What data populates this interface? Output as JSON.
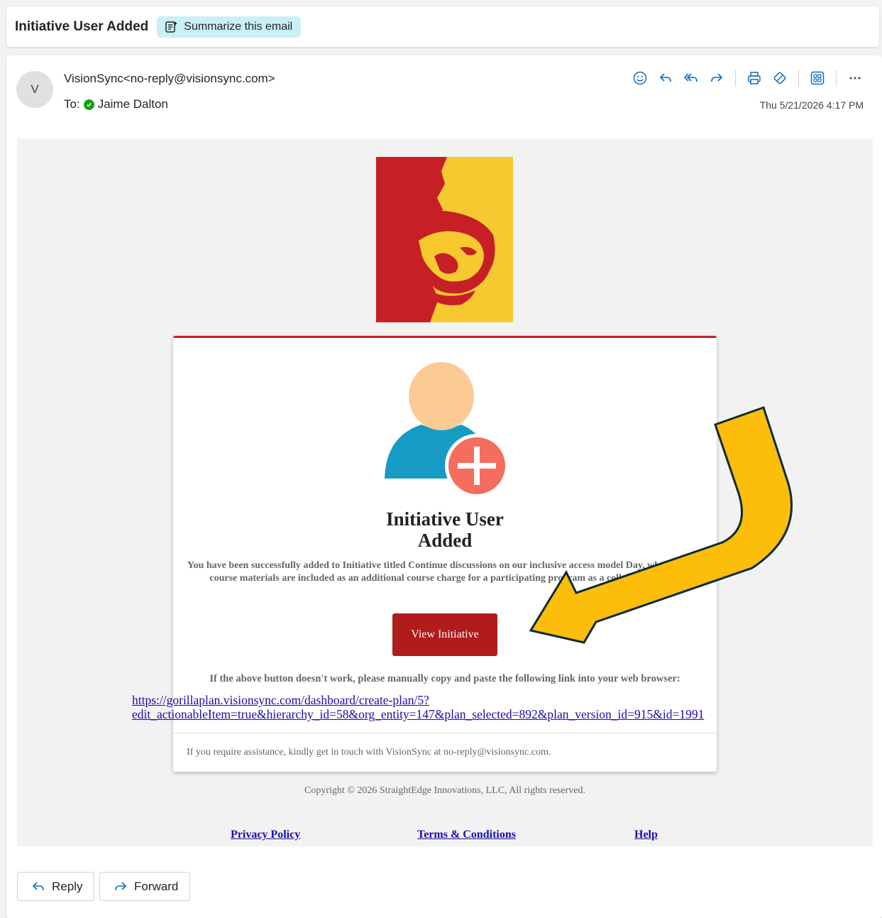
{
  "subject": {
    "title": "Initiative User Added",
    "summarize_label": "Summarize this email"
  },
  "message": {
    "avatar_initial": "V",
    "sender_name": "VisionSync",
    "sender_email": "<no-reply@visionsync.com>",
    "to_label": "To:",
    "recipient": "Jaime Dalton",
    "timestamp": "Thu 5/21/2026 4:17 PM"
  },
  "toolbar": {
    "icons": [
      "emoji-icon",
      "reply-icon",
      "reply-all-icon",
      "forward-icon",
      "print-icon",
      "immersive-reader-icon",
      "apps-icon",
      "more-icon"
    ]
  },
  "email": {
    "card_title": "Initiative User Added",
    "description": "You have been successfully added to Initiative titled Continue discussions on our inclusive access model Day, where digital course materials are included as an additional course charge for a participating program as a collaborator role.",
    "view_button": "View Initiative",
    "manual_note": "If the above button doesn't work, please manually copy and paste the following link into your web browser:",
    "manual_link": "https://gorillaplan.visionsync.com/dashboard/create-plan/5?edit_actionableItem=true&hierarchy_id=58&org_entity=147&plan_selected=892&plan_version_id=915&id=1991",
    "assist_text": "If you require assistance, kindly get in touch with VisionSync at no-reply@visionsync.com.",
    "copyright": "Copyright © 2026 StraightEdge Innovations, LLC, All rights reserved.",
    "footer_links": {
      "privacy": "Privacy Policy",
      "terms": "Terms & Conditions",
      "help": "Help"
    }
  },
  "actions": {
    "reply": "Reply",
    "forward": "Forward"
  },
  "colors": {
    "logo_red": "#c62026",
    "logo_gold": "#f6c931",
    "button_red": "#b01b1b",
    "arrow_yellow": "#fcbd0b",
    "link_blue": "#1a0dab",
    "toolbar_blue": "#0f6cbd"
  }
}
